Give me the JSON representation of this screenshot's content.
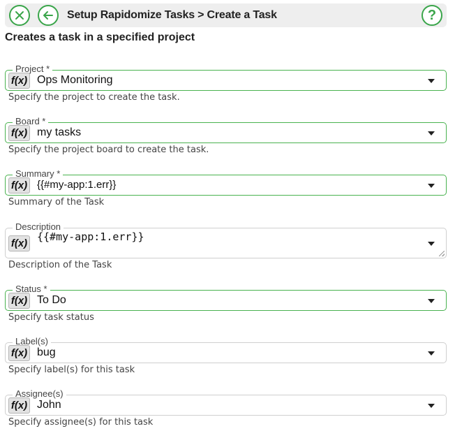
{
  "header": {
    "title": "Setup Rapidomize Tasks > Create a Task",
    "close_icon": "close-icon",
    "back_icon": "arrow-left-icon",
    "help_icon": "question-icon",
    "help_glyph": "?"
  },
  "subtitle": "Creates a task in a specified project",
  "accent_color": "#3aa54a",
  "fx_label": "f(x)",
  "fields": [
    {
      "label": "Project *",
      "value": "Ops Monitoring",
      "help": "Specify the project to create the task."
    },
    {
      "label": "Board *",
      "value": "my tasks",
      "help": "Specify the project board to create the task."
    },
    {
      "label": "Summary *",
      "value": "{{#my-app:1.err}}",
      "help": "Summary of the Task"
    },
    {
      "label": "Description",
      "value": "{{#my-app:1.err}}",
      "help": "Description of the Task"
    },
    {
      "label": "Status *",
      "value": "To Do",
      "help": "Specify task status"
    },
    {
      "label": "Label(s)",
      "value": "bug",
      "help": "Specify label(s) for this task"
    },
    {
      "label": "Assignee(s)",
      "value": "John",
      "help": "Specify assignee(s) for this task"
    }
  ]
}
